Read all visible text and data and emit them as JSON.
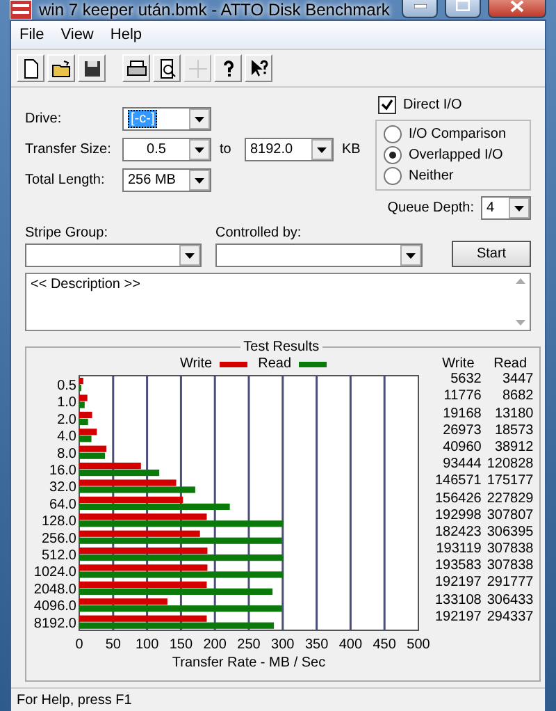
{
  "window": {
    "title": "win 7 keeper után.bmk - ATTO Disk Benchmark"
  },
  "menu": [
    "File",
    "View",
    "Help"
  ],
  "toolbar": [
    {
      "kind": "new",
      "disabled": false
    },
    {
      "kind": "open",
      "disabled": false
    },
    {
      "kind": "save",
      "disabled": false
    },
    {
      "kind": "print",
      "disabled": false
    },
    {
      "kind": "preview",
      "disabled": false
    },
    {
      "kind": "move",
      "disabled": true
    },
    {
      "kind": "help",
      "disabled": false
    },
    {
      "kind": "context-help",
      "disabled": false
    }
  ],
  "settings": {
    "drive": {
      "label": "Drive:",
      "value": "[-c-]",
      "highlighted": true
    },
    "transfer_size": {
      "label": "Transfer Size:",
      "from": "0.5",
      "to_label": "to",
      "to": "8192.0",
      "unit": "KB"
    },
    "total_length": {
      "label": "Total Length:",
      "value": "256 MB"
    },
    "direct_io": {
      "label": "Direct I/O",
      "checked": true
    },
    "io_modes": [
      {
        "label": "I/O Comparison",
        "selected": false
      },
      {
        "label": "Overlapped I/O",
        "selected": true
      },
      {
        "label": "Neither",
        "selected": false
      }
    ],
    "queue_depth": {
      "label": "Queue Depth:",
      "value": "4"
    },
    "stripe_group": {
      "label": "Stripe Group:"
    },
    "controlled_by": {
      "label": "Controlled by:"
    },
    "start_button": "Start"
  },
  "description": "<< Description >>",
  "results": {
    "chart_data": {
      "type": "bar",
      "orientation": "horizontal",
      "title": "Test Results",
      "xlabel": "Transfer Rate - MB / Sec",
      "categories": [
        "0.5",
        "1.0",
        "2.0",
        "4.0",
        "8.0",
        "16.0",
        "32.0",
        "64.0",
        "128.0",
        "256.0",
        "512.0",
        "1024.0",
        "2048.0",
        "4096.0",
        "8192.0"
      ],
      "xlim": [
        0,
        500
      ],
      "xticks": [
        0,
        50,
        100,
        150,
        200,
        250,
        300,
        350,
        400,
        450,
        500
      ],
      "grid": true,
      "series": [
        {
          "name": "Write",
          "color": "#d40000",
          "values": [
            6,
            12,
            19,
            26,
            40,
            91,
            143,
            153,
            188,
            178,
            189,
            189,
            188,
            130,
            188
          ]
        },
        {
          "name": "Read",
          "color": "#0a7a0a",
          "values": [
            3,
            8,
            13,
            18,
            38,
            118,
            171,
            222,
            301,
            299,
            301,
            301,
            285,
            299,
            287
          ]
        }
      ]
    },
    "table": {
      "columns": [
        "Write",
        "Read"
      ],
      "rows": [
        [
          "5632",
          "3447"
        ],
        [
          "11776",
          "8682"
        ],
        [
          "19168",
          "13180"
        ],
        [
          "26973",
          "18573"
        ],
        [
          "40960",
          "38912"
        ],
        [
          "93444",
          "120828"
        ],
        [
          "146571",
          "175177"
        ],
        [
          "156426",
          "227829"
        ],
        [
          "192998",
          "307807"
        ],
        [
          "182423",
          "306395"
        ],
        [
          "193119",
          "307838"
        ],
        [
          "193583",
          "307838"
        ],
        [
          "192197",
          "291777"
        ],
        [
          "133108",
          "306433"
        ],
        [
          "192197",
          "294337"
        ]
      ]
    }
  },
  "status_bar": "For Help, press F1"
}
